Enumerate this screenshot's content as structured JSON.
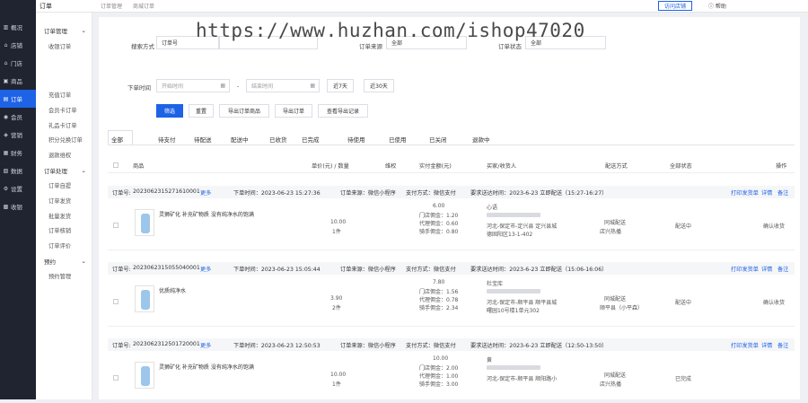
{
  "sidebar": {
    "items": [
      {
        "label": "概况",
        "icon": "chart-icon"
      },
      {
        "label": "店铺",
        "icon": "store-icon"
      },
      {
        "label": "门店",
        "icon": "shop-icon"
      },
      {
        "label": "商品",
        "icon": "goods-icon"
      },
      {
        "label": "订单",
        "icon": "order-icon"
      },
      {
        "label": "会员",
        "icon": "user-icon"
      },
      {
        "label": "营销",
        "icon": "marketing-icon"
      },
      {
        "label": "财务",
        "icon": "finance-icon"
      },
      {
        "label": "数据",
        "icon": "data-icon"
      },
      {
        "label": "设置",
        "icon": "gear-icon"
      },
      {
        "label": "收银",
        "icon": "cashier-icon"
      }
    ]
  },
  "subnav": {
    "group1": "订单管理",
    "item_all": "收银订单",
    "items_a": [
      "充值订单",
      "会员卡订单",
      "礼品卡订单",
      "积分兑换订单",
      "退款维权"
    ],
    "group2": "订单处理",
    "items_b": [
      "订单自提",
      "订单发货",
      "批量发货",
      "订单核销",
      "订单评价"
    ],
    "group3": "预约",
    "item_c": "预约管理"
  },
  "topbar": {
    "title": "订单",
    "crumb1": "订单管理",
    "crumb2": "商城订单",
    "visit_store": "访问店铺",
    "help": "帮助"
  },
  "watermark": "https://www.huzhan.com/ishop47020",
  "filters": {
    "search_label": "搜索方式",
    "search_type": "订单号",
    "source_label": "订单来源",
    "source_value": "全部",
    "status_label": "订单状态",
    "status_value": "全部",
    "time_label": "下单时间",
    "start_placeholder": "开始时间",
    "end_placeholder": "结束时间",
    "days7": "近7天",
    "days30": "近30天",
    "filter_btn": "筛选",
    "reset_btn": "重置",
    "export_goods": "导出订单商品",
    "export_order": "导出订单",
    "view_export": "查看导出记录"
  },
  "tabs": [
    "全部",
    "待支付",
    "待配送",
    "配送中",
    "已收货",
    "已完成",
    "待使用",
    "已使用",
    "已关闭",
    "退款中"
  ],
  "table_headers": {
    "goods": "商品",
    "price_qty": "单价(元) / 数量",
    "maintain": "维权",
    "paid": "实付金额(元)",
    "buyer": "买家/收货人",
    "delivery": "配送方式",
    "status": "全部状态",
    "ops": "操作"
  },
  "orders": [
    {
      "no_label": "订单号:",
      "no": "2023062315271610001",
      "more": "更多",
      "time": "下单时间：2023-06-23 15:27:36",
      "source": "订单来源：微信小程序",
      "pay": "支付方式：微信支付",
      "delivery_req": "要求送达时间：2023-6-23 立即配送（15:27-16:27）",
      "print": "打印发货单",
      "detail": "详情",
      "remark": "备注",
      "goods": "灵狮矿化 补充矿物质 没有纯净水的饱满",
      "price": "10.00",
      "qty": "1件",
      "paid": "6.00",
      "f1": "门店佣金：1.20",
      "f2": "代理佣金：0.60",
      "f3": "骑手佣金：0.80",
      "buyer": "心语",
      "addr1": "河北-保定市-定兴县 定兴县城",
      "addr2": "德固阳区13-1-402",
      "delivery": "同城配送",
      "rider": "店兴热播",
      "status": "配送中",
      "op": "确认收货"
    },
    {
      "no_label": "订单号:",
      "no": "2023062315055040001",
      "more": "更多",
      "time": "下单时间：2023-06-23 15:05:44",
      "source": "订单来源：微信小程序",
      "pay": "支付方式：微信支付",
      "delivery_req": "要求送达时间：2023-6-23 立即配送（15:06-16:06）",
      "print": "打印发货单",
      "detail": "详情",
      "remark": "备注",
      "goods": "优质纯净水",
      "price": "3.90",
      "qty": "2件",
      "paid": "7.80",
      "f1": "门店佣金：1.56",
      "f2": "代理佣金：0.78",
      "f3": "骑手佣金：2.34",
      "buyer": "杜宝库",
      "addr1": "河北-保定市-顺平县 顺平县城",
      "addr2": "曙园10号楼1单元302",
      "delivery": "同城配送",
      "rider": "顺平县（小平森）",
      "status": "配送中",
      "op": "确认收货"
    },
    {
      "no_label": "订单号:",
      "no": "2023062312501720001",
      "more": "更多",
      "time": "下单时间：2023-06-23 12:50:53",
      "source": "订单来源：微信小程序",
      "pay": "支付方式：微信支付",
      "delivery_req": "要求送达时间：2023-6-23 立即配送（12:50-13:50）",
      "print": "打印发货单",
      "detail": "详情",
      "remark": "备注",
      "goods": "灵狮矿化 补充矿物质 没有纯净水的饱满",
      "price": "10.00",
      "qty": "1件",
      "paid": "10.00",
      "f1": "门店佣金：2.00",
      "f2": "代理佣金：1.00",
      "f3": "骑手佣金：3.00",
      "buyer": "黄",
      "addr1": "河北-保定市-顺平县 顺阳路小",
      "addr2": "",
      "delivery": "同城配送",
      "rider": "店兴热播",
      "status": "已完成",
      "op": ""
    }
  ]
}
